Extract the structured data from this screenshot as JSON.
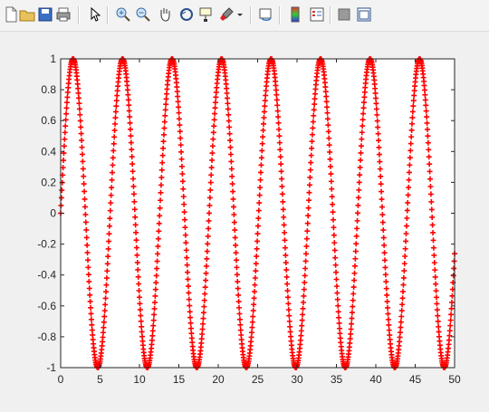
{
  "toolbar": {
    "icons": [
      "new-figure-icon",
      "open-file-icon",
      "save-icon",
      "print-icon",
      "edit-plot-icon",
      "zoom-in-icon",
      "zoom-out-icon",
      "pan-icon",
      "rotate-3d-icon",
      "data-cursor-icon",
      "brush-icon",
      "link-plot-icon",
      "insert-colorbar-icon",
      "insert-legend-icon",
      "hide-plot-tools-icon",
      "show-plot-tools-icon"
    ]
  },
  "chart_data": {
    "type": "scatter",
    "title": "",
    "xlabel": "",
    "ylabel": "",
    "xlim": [
      0,
      50
    ],
    "ylim": [
      -1,
      1
    ],
    "x_ticks": [
      "0",
      "5",
      "10",
      "15",
      "20",
      "25",
      "30",
      "35",
      "40",
      "45",
      "50"
    ],
    "y_ticks": [
      "1",
      "0.8",
      "0.6",
      "0.4",
      "0.2",
      "0",
      "-0.2",
      "-0.4",
      "-0.6",
      "-0.8",
      "-1"
    ],
    "marker": "+",
    "color": "#ff0000",
    "series": [
      {
        "function": "sin(x)",
        "x_start": 0,
        "x_end": 50,
        "x_step": 0.05
      }
    ],
    "grid": false,
    "legend": "none"
  }
}
